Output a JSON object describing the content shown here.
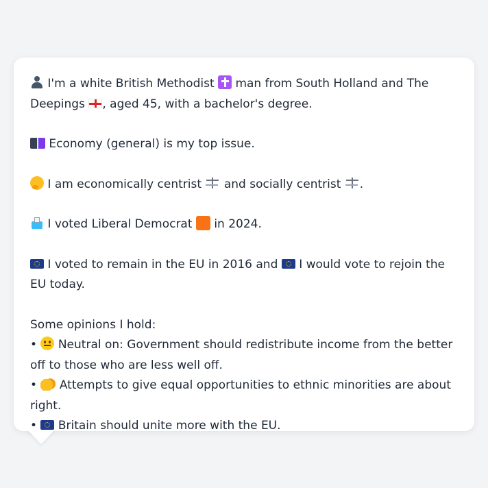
{
  "message": {
    "intro": {
      "icon": "bust-in-silhouette-icon",
      "part1": "I'm a white British Methodist",
      "icon2": "latin-cross-icon",
      "part2": "man from South Holland and The Deepings",
      "icon3": "england-flag-icon",
      "part3": ", aged 45, with a bachelor's degree."
    },
    "issue": {
      "icon": "ledger-icon",
      "text": "Economy (general) is my top issue."
    },
    "stance": {
      "icon": "thinking-face-icon",
      "part1": "I am economically centrist",
      "icon2": "balance-scale-icon",
      "part2": "and socially centrist",
      "icon3": "balance-scale-icon",
      "part3": "."
    },
    "vote": {
      "icon": "ballot-box-icon",
      "part1": "I voted Liberal Democrat",
      "icon2": "orange-square-icon",
      "part2": "in 2024."
    },
    "eu": {
      "icon": "eu-flag-icon",
      "part1": "I voted to remain in the EU in 2016 and",
      "icon2": "eu-flag-icon",
      "part2": "I would vote to rejoin the EU today."
    },
    "opinions": {
      "heading": "Some opinions I hold:",
      "bullet": "•",
      "items": [
        {
          "icon": "neutral-face-icon",
          "text": "Neutral on: Government should redistribute income from the better off to those who are less well off."
        },
        {
          "icon": "handshake-icon",
          "text": "Attempts to give equal opportunities to ethnic minorities are about right."
        },
        {
          "icon": "eu-flag-icon",
          "text": "Britain should unite more with the EU."
        }
      ]
    }
  },
  "colors": {
    "background": "#f3f4f6",
    "bubble": "#ffffff",
    "text": "#1f2937",
    "lib_dem_orange": "#f97316"
  }
}
